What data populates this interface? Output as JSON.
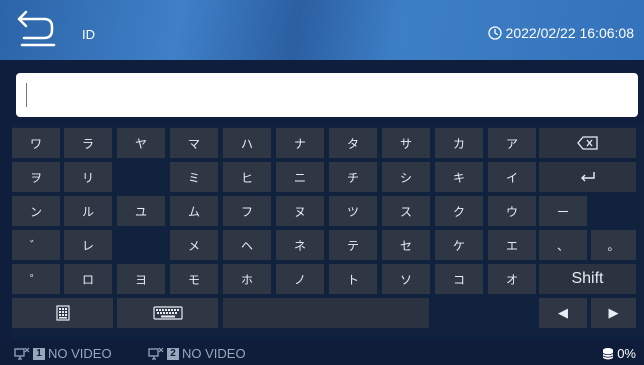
{
  "header": {
    "title": "ID",
    "datetime": "2022/02/22 16:06:08"
  },
  "input": {
    "value": ""
  },
  "keyboard": {
    "rows": [
      [
        {
          "label": "ワ",
          "name": "key-wa"
        },
        {
          "label": "ラ",
          "name": "key-ra"
        },
        {
          "label": "ヤ",
          "name": "key-ya"
        },
        {
          "label": "マ",
          "name": "key-ma"
        },
        {
          "label": "ハ",
          "name": "key-ha"
        },
        {
          "label": "ナ",
          "name": "key-na"
        },
        {
          "label": "タ",
          "name": "key-ta"
        },
        {
          "label": "サ",
          "name": "key-sa"
        },
        {
          "label": "カ",
          "name": "key-ka"
        },
        {
          "label": "ア",
          "name": "key-a"
        }
      ],
      [
        {
          "label": "ヲ",
          "name": "key-wo"
        },
        {
          "label": "リ",
          "name": "key-ri"
        },
        null,
        {
          "label": "ミ",
          "name": "key-mi"
        },
        {
          "label": "ヒ",
          "name": "key-hi"
        },
        {
          "label": "ニ",
          "name": "key-ni"
        },
        {
          "label": "チ",
          "name": "key-chi"
        },
        {
          "label": "シ",
          "name": "key-shi"
        },
        {
          "label": "キ",
          "name": "key-ki"
        },
        {
          "label": "イ",
          "name": "key-i"
        }
      ],
      [
        {
          "label": "ン",
          "name": "key-n"
        },
        {
          "label": "ル",
          "name": "key-ru"
        },
        {
          "label": "ユ",
          "name": "key-yu"
        },
        {
          "label": "ム",
          "name": "key-mu"
        },
        {
          "label": "フ",
          "name": "key-fu"
        },
        {
          "label": "ヌ",
          "name": "key-nu"
        },
        {
          "label": "ツ",
          "name": "key-tsu"
        },
        {
          "label": "ス",
          "name": "key-su"
        },
        {
          "label": "ク",
          "name": "key-ku"
        },
        {
          "label": "ウ",
          "name": "key-u"
        }
      ],
      [
        {
          "label": "゛",
          "name": "key-dakuten"
        },
        {
          "label": "レ",
          "name": "key-re"
        },
        null,
        {
          "label": "メ",
          "name": "key-me"
        },
        {
          "label": "ヘ",
          "name": "key-he"
        },
        {
          "label": "ネ",
          "name": "key-ne"
        },
        {
          "label": "テ",
          "name": "key-te"
        },
        {
          "label": "セ",
          "name": "key-se"
        },
        {
          "label": "ケ",
          "name": "key-ke"
        },
        {
          "label": "エ",
          "name": "key-e"
        }
      ],
      [
        {
          "label": "゜",
          "name": "key-handakuten"
        },
        {
          "label": "ロ",
          "name": "key-ro"
        },
        {
          "label": "ヨ",
          "name": "key-yo"
        },
        {
          "label": "モ",
          "name": "key-mo"
        },
        {
          "label": "ホ",
          "name": "key-ho"
        },
        {
          "label": "ノ",
          "name": "key-no"
        },
        {
          "label": "ト",
          "name": "key-to"
        },
        {
          "label": "ソ",
          "name": "key-so"
        },
        {
          "label": "コ",
          "name": "key-ko"
        },
        {
          "label": "オ",
          "name": "key-o"
        }
      ]
    ],
    "right_keys": {
      "backspace": "backspace-icon",
      "enter": "enter-icon",
      "long_vowel": "ー",
      "comma": "、",
      "period": "。",
      "shift": "Shift",
      "left_arrow": "◀",
      "right_arrow": "▶"
    },
    "bottom_row": {
      "numeric_mode": "numeric-keypad-icon",
      "keyboard_mode": "keyboard-icon"
    }
  },
  "status_bar": {
    "camera1_num": "1",
    "camera1_text": "NO VIDEO",
    "camera2_num": "2",
    "camera2_text": "NO VIDEO",
    "storage": "0%"
  },
  "colors": {
    "header_blue": "#3473bb",
    "key_gray": "#2f3644",
    "background": "#0e1e3c"
  }
}
